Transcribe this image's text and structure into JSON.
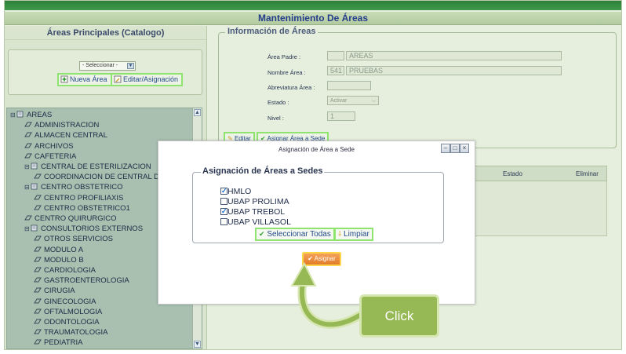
{
  "window": {
    "title": "Mantenimiento De Áreas"
  },
  "left": {
    "header": "Áreas Principales (Catalogo)",
    "select_value": "- Seleccionar -",
    "btn_new": "Nueva Área",
    "btn_edit": "Editar/Asignación"
  },
  "tree": {
    "items": [
      {
        "label": "AREAS",
        "level": 0,
        "node": "root"
      },
      {
        "label": "ADMINISTRACION",
        "level": 1,
        "node": "leaf"
      },
      {
        "label": "ALMACEN CENTRAL",
        "level": 1,
        "node": "leaf"
      },
      {
        "label": "ARCHIVOS",
        "level": 1,
        "node": "leaf"
      },
      {
        "label": "CAFETERIA",
        "level": 1,
        "node": "leaf"
      },
      {
        "label": "CENTRAL DE ESTERILIZACION",
        "level": 1,
        "node": "branch"
      },
      {
        "label": "COORDINACION DE CENTRAL DE E",
        "level": 2,
        "node": "leaf"
      },
      {
        "label": "CENTRO OBSTETRICO",
        "level": 1,
        "node": "branch"
      },
      {
        "label": "CENTRO PROFILIAXIS",
        "level": 2,
        "node": "leaf"
      },
      {
        "label": "CENTRO OBSTETRICO1",
        "level": 2,
        "node": "leaf"
      },
      {
        "label": "CENTRO QUIRURGICO",
        "level": 1,
        "node": "leaf"
      },
      {
        "label": "CONSULTORIOS EXTERNOS",
        "level": 1,
        "node": "branch"
      },
      {
        "label": "OTROS SERVICIOS",
        "level": 2,
        "node": "leaf"
      },
      {
        "label": "MODULO A",
        "level": 2,
        "node": "leaf"
      },
      {
        "label": "MODULO B",
        "level": 2,
        "node": "leaf"
      },
      {
        "label": "CARDIOLOGIA",
        "level": 2,
        "node": "leaf"
      },
      {
        "label": "GASTROENTEROLOGIA",
        "level": 2,
        "node": "leaf"
      },
      {
        "label": "CIRUGIA",
        "level": 2,
        "node": "leaf"
      },
      {
        "label": "GINECOLOGIA",
        "level": 2,
        "node": "leaf"
      },
      {
        "label": "OFTALMOLOGIA",
        "level": 2,
        "node": "leaf"
      },
      {
        "label": "ODONTOLOGIA",
        "level": 2,
        "node": "leaf"
      },
      {
        "label": "TRAUMATOLOGIA",
        "level": 2,
        "node": "leaf"
      },
      {
        "label": "PEDIATRIA",
        "level": 2,
        "node": "leaf"
      }
    ]
  },
  "info": {
    "legend": "Información de Áreas",
    "labels": {
      "area_padre": "Área Padre :",
      "nombre_area": "Nombre Área :",
      "abreviatura": "Abreviatura Área :",
      "estado": "Estado :",
      "nivel": "Nivel :"
    },
    "values": {
      "padre_code": "",
      "padre_name": "AREAS",
      "nombre_code": "541",
      "nombre_name": "PRUEBAS",
      "abreviatura": "",
      "estado": "Activar",
      "nivel": "1"
    },
    "btn_editar": "Editar",
    "btn_asignar_sede": "Asignar Área a Sede"
  },
  "grid": {
    "col_estado": "Estado",
    "col_eliminar": "Eliminar"
  },
  "dialog": {
    "title": "Asignación de Área a Sede",
    "legend": "Asignación de Áreas a Sedes",
    "sedes": [
      {
        "label": "HMLO",
        "checked": true
      },
      {
        "label": "UBAP PROLIMA",
        "checked": false
      },
      {
        "label": "UBAP TREBOL",
        "checked": true
      },
      {
        "label": "UBAP VILLASOL",
        "checked": false
      }
    ],
    "btn_select_all": "Seleccionar Todas",
    "btn_clear": "Limpiar",
    "btn_assign": "Asignar"
  },
  "callout": {
    "label": "Click"
  }
}
